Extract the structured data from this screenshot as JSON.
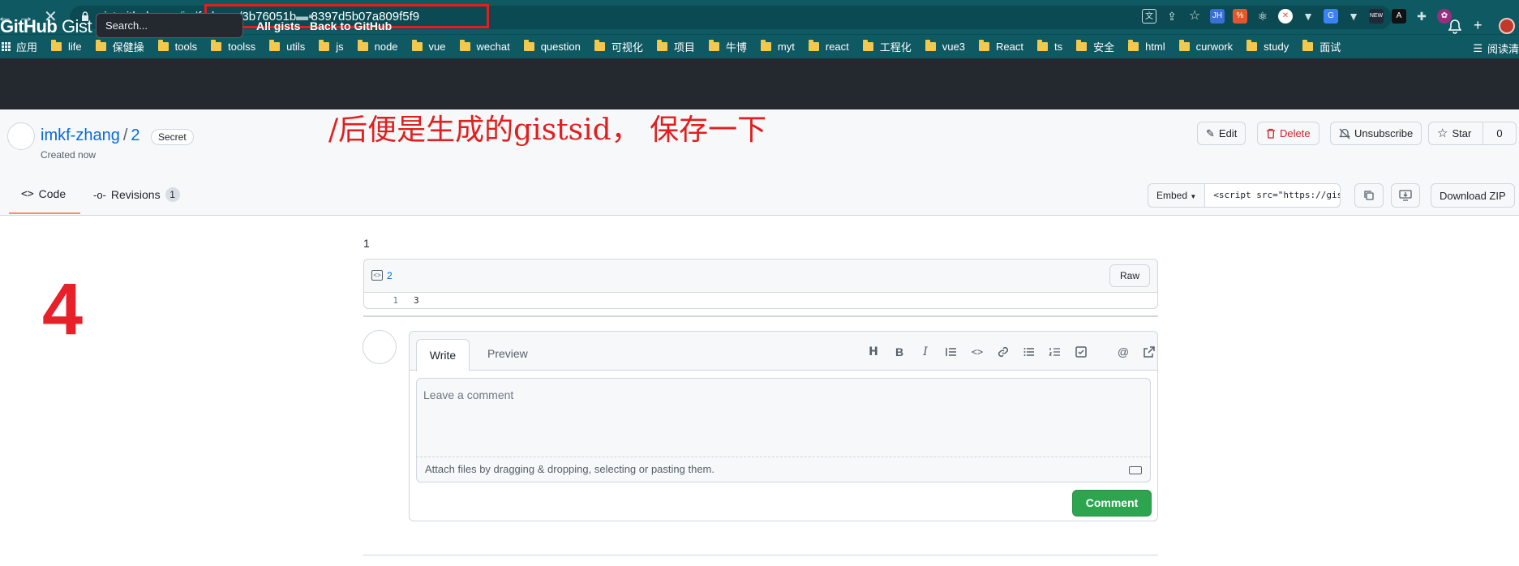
{
  "browser": {
    "back_icon": "arrow-left-icon",
    "forward_icon": "arrow-right-icon",
    "stop_icon": "close-icon",
    "url_host": "gist.github.com",
    "url_path_visible": "/iml",
    "url_path_highlighted": "f-zhang/3b76051b",
    "url_path_tail": "8397d5b07a809f5f9",
    "bookmarks": [
      "应用",
      "life",
      "保健操",
      "tools",
      "toolss",
      "utils",
      "js",
      "node",
      "vue",
      "wechat",
      "question",
      "可视化",
      "项目",
      "牛博",
      "myt",
      "react",
      "工程化",
      "vue3",
      "React",
      "ts",
      "安全",
      "html",
      "curwork",
      "study",
      "面试"
    ],
    "reading_list": "阅读清"
  },
  "header": {
    "logo_bold": "GitHub",
    "logo_light": " Gist",
    "search_placeholder": "Search...",
    "links": [
      "All gists",
      "Back to GitHub"
    ]
  },
  "gist": {
    "owner": "imkf-zhang",
    "separator": "/",
    "name": "2",
    "badge": "Secret",
    "created": "Created now",
    "annotation": "/后便是生成的gistsid，  保存一下",
    "actions": {
      "edit": "Edit",
      "delete": "Delete",
      "unsubscribe": "Unsubscribe",
      "star": "Star",
      "star_count": "0"
    },
    "tabs": {
      "code": "Code",
      "revisions": "Revisions",
      "revisions_count": "1"
    },
    "embed_label": "Embed",
    "embed_value": "<script src=\"https://gist.github.com/",
    "download": "Download ZIP"
  },
  "content": {
    "step_number": "4",
    "description": "1",
    "file": {
      "name": "2",
      "raw_label": "Raw",
      "lines": [
        {
          "num": "1",
          "code": "3"
        }
      ]
    }
  },
  "comment": {
    "write_tab": "Write",
    "preview_tab": "Preview",
    "placeholder": "Leave a comment",
    "attach_hint": "Attach files by dragging & dropping, selecting or pasting them.",
    "submit": "Comment"
  },
  "colors": {
    "chrome": "#0f5963",
    "header": "#24292f",
    "annotation": "#e02020",
    "primary_button": "#2da44e",
    "link": "#0969da"
  }
}
